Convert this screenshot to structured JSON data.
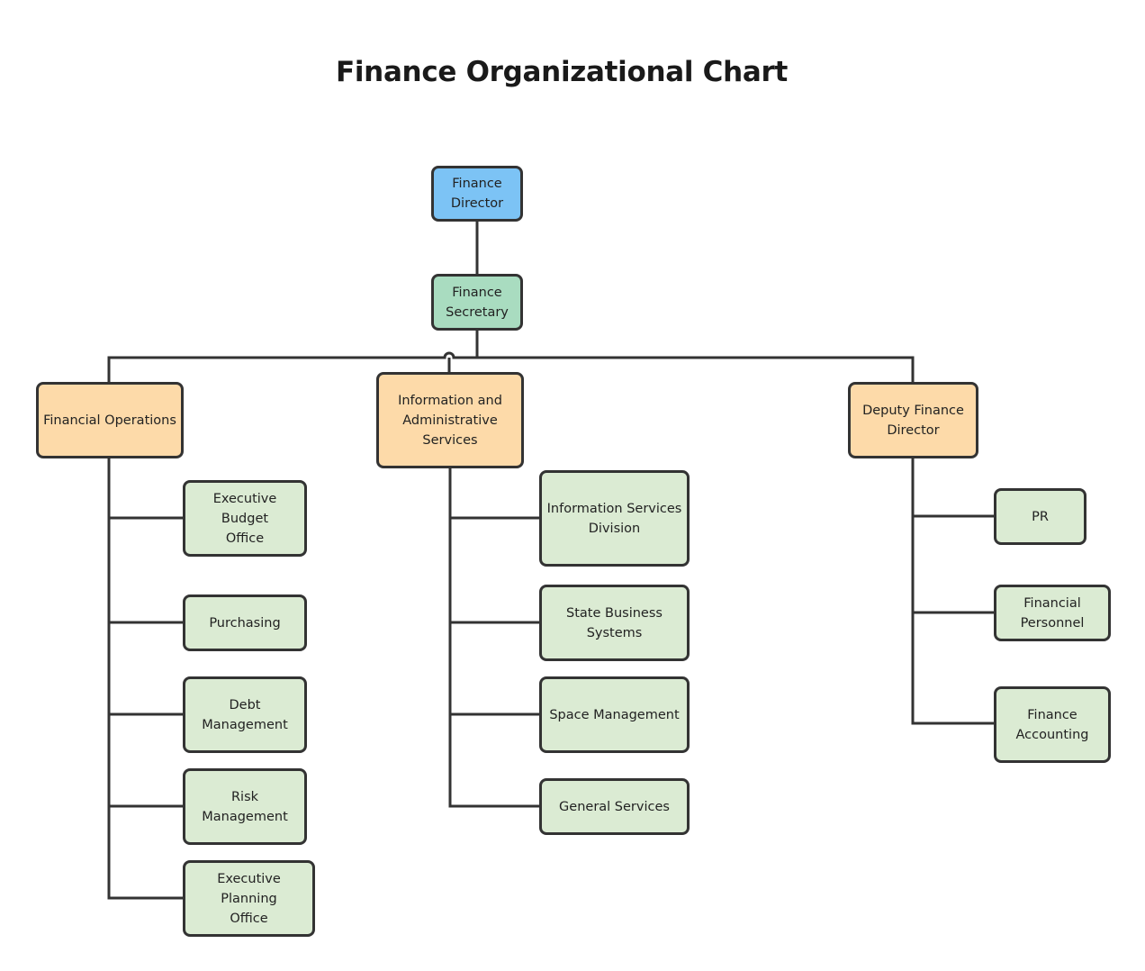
{
  "title": "Finance Organizational Chart",
  "colors": {
    "director": "#7cc3f5",
    "secretary": "#a9dcc0",
    "division": "#fddaa9",
    "unit": "#dbebd3",
    "line": "#333333"
  },
  "nodes": {
    "director": "Finance\nDirector",
    "secretary": "Finance\nSecretary",
    "financial_operations": "Financial Operations",
    "info_admin": "Information and\nAdministrative\nServices",
    "deputy": "Deputy Finance\nDirector",
    "exec_budget": "Executive Budget\nOffice",
    "purchasing": "Purchasing",
    "debt_mgmt": "Debt\nManagement",
    "risk_mgmt": "Risk\nManagement",
    "exec_planning": "Executive Planning\nOffice",
    "info_services": "Information Services\nDivision",
    "state_business": "State Business\nSystems",
    "space_mgmt": "Space Management",
    "general_services": "General Services",
    "pr": "PR",
    "fin_personnel": "Financial\nPersonnel",
    "fin_accounting": "Finance\nAccounting"
  },
  "hierarchy": {
    "director": [
      "secretary"
    ],
    "secretary": [
      "financial_operations",
      "info_admin",
      "deputy"
    ],
    "financial_operations": [
      "exec_budget",
      "purchasing",
      "debt_mgmt",
      "risk_mgmt",
      "exec_planning"
    ],
    "info_admin": [
      "info_services",
      "state_business",
      "space_mgmt",
      "general_services"
    ],
    "deputy": [
      "pr",
      "fin_personnel",
      "fin_accounting"
    ]
  }
}
